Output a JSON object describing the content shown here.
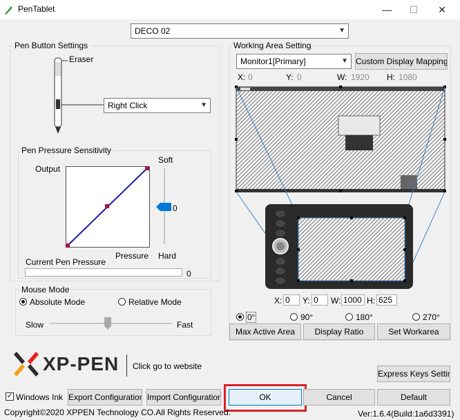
{
  "window": {
    "title": "PenTablet",
    "minimize": "—",
    "maximize": "☐",
    "close": "✕"
  },
  "device": {
    "selected": "DECO 02"
  },
  "pen_button": {
    "group_label": "Pen Button Settings",
    "eraser_label": "Eraser",
    "button_value": "Right Click"
  },
  "pressure": {
    "group_label": "Pen Pressure Sensitivity",
    "output_label": "Output",
    "pressure_label": "Pressure",
    "soft_label": "Soft",
    "hard_label": "Hard",
    "slider_value": "0",
    "current_label": "Current Pen Pressure",
    "current_value": "0"
  },
  "mouse_mode": {
    "group_label": "Mouse Mode",
    "absolute": "Absolute Mode",
    "relative": "Relative Mode",
    "slow": "Slow",
    "fast": "Fast"
  },
  "working_area": {
    "group_label": "Working Area Setting",
    "monitor": "Monitor1[Primary]",
    "custom_mapping": "Custom Display Mapping",
    "x_label": "X:",
    "x_value": "0",
    "y_label": "Y:",
    "y_value": "0",
    "w_label": "W:",
    "w_value": "1920",
    "h_label": "H:",
    "h_value": "1080",
    "tab_x_label": "X:",
    "tab_x_value": "0",
    "tab_y_label": "Y:",
    "tab_y_value": "0",
    "tab_w_label": "W:",
    "tab_w_value": "1000",
    "tab_h_label": "H:",
    "tab_h_value": "625",
    "rot0": "0°",
    "rot90": "90°",
    "rot180": "180°",
    "rot270": "270°",
    "max_area": "Max Active Area",
    "display_ratio": "Display Ratio",
    "set_workarea": "Set Workarea"
  },
  "brand": {
    "logo_text": "XP-PEN",
    "website_link": "Click go to website"
  },
  "footer": {
    "express_keys": "Express Keys Setting",
    "windows_ink": "Windows Ink",
    "export": "Export Configuration",
    "import": "Import Configuration",
    "ok": "OK",
    "cancel": "Cancel",
    "default": "Default",
    "copyright": "Copyright©2020 XPPEN Technology CO.All Rights Reserved.",
    "version": "Ver:1.6.4(Build:1a6d3391)"
  },
  "colors": {
    "accent": "#0078d7",
    "highlight_box": "#d9212c",
    "curve": "#1a1aa8",
    "curve_point": "#9b1a4a"
  }
}
